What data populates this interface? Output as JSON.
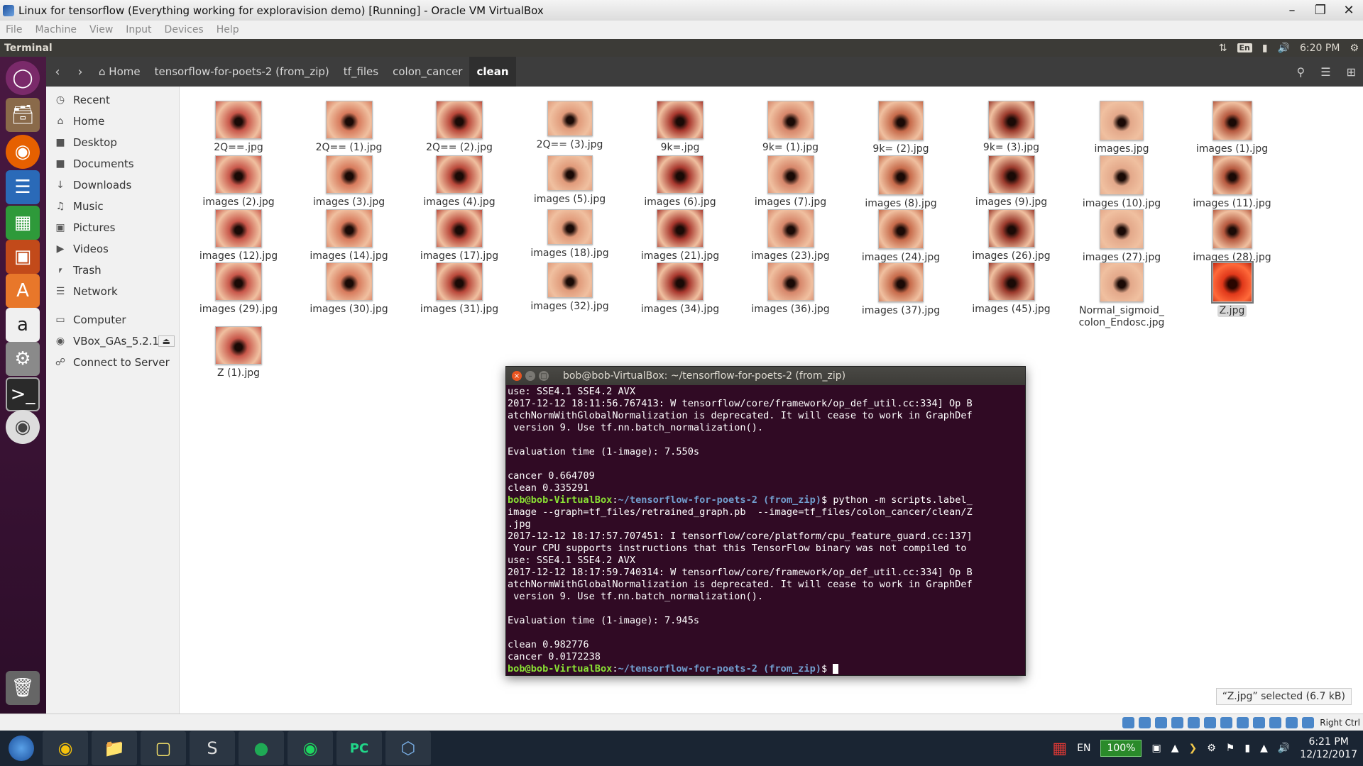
{
  "vbox": {
    "title": "Linux for tensorflow (Everything working for exploravision demo) [Running] - Oracle VM VirtualBox",
    "menu": [
      "File",
      "Machine",
      "View",
      "Input",
      "Devices",
      "Help"
    ],
    "status_right": "Right Ctrl"
  },
  "panel": {
    "app_name": "Terminal",
    "keyboard": "En",
    "time": "6:20 PM"
  },
  "nautilus": {
    "breadcrumbs": [
      "Home",
      "tensorflow-for-poets-2 (from_zip)",
      "tf_files",
      "colon_cancer",
      "clean"
    ],
    "sidebar": [
      {
        "label": "Recent",
        "icon": "clock-icon"
      },
      {
        "label": "Home",
        "icon": "home-icon"
      },
      {
        "label": "Desktop",
        "icon": "folder-icon"
      },
      {
        "label": "Documents",
        "icon": "folder-icon"
      },
      {
        "label": "Downloads",
        "icon": "download-icon"
      },
      {
        "label": "Music",
        "icon": "music-icon"
      },
      {
        "label": "Pictures",
        "icon": "camera-icon"
      },
      {
        "label": "Videos",
        "icon": "video-icon"
      },
      {
        "label": "Trash",
        "icon": "trash-icon"
      },
      {
        "label": "Network",
        "icon": "network-icon"
      },
      {
        "label": "Computer",
        "icon": "computer-icon"
      },
      {
        "label": "VBox_GAs_5.2.1",
        "icon": "disc-icon"
      },
      {
        "label": "Connect to Server",
        "icon": "server-icon"
      }
    ],
    "files": [
      "2Q==.jpg",
      "2Q== (1).jpg",
      "2Q== (2).jpg",
      "2Q== (3).jpg",
      "9k=.jpg",
      "9k= (1).jpg",
      "9k= (2).jpg",
      "9k= (3).jpg",
      "images.jpg",
      "images (1).jpg",
      "images (2).jpg",
      "images (3).jpg",
      "images (4).jpg",
      "images (5).jpg",
      "images (6).jpg",
      "images (7).jpg",
      "images (8).jpg",
      "images (9).jpg",
      "images (10).jpg",
      "images (11).jpg",
      "images (12).jpg",
      "images (14).jpg",
      "images (17).jpg",
      "images (18).jpg",
      "images (21).jpg",
      "images (23).jpg",
      "images (24).jpg",
      "images (26).jpg",
      "images (27).jpg",
      "images (28).jpg",
      "images (29).jpg",
      "images (30).jpg",
      "images (31).jpg",
      "images (32).jpg",
      "images (34).jpg",
      "images (36).jpg",
      "images (37).jpg",
      "images (45).jpg",
      "Normal_sigmoid_\ncolon_Endosc.jpg",
      "Z.jpg",
      "Z (1).jpg"
    ],
    "selected_file": "Z.jpg",
    "status": "“Z.jpg” selected (6.7 kB)"
  },
  "terminal": {
    "title": "bob@bob-VirtualBox: ~/tensorflow-for-poets-2 (from_zip)",
    "prompt_user": "bob@bob-VirtualBox",
    "prompt_path": "~/tensorflow-for-poets-2 (from_zip)",
    "lines_before": "use: SSE4.1 SSE4.2 AVX\n2017-12-12 18:11:56.767413: W tensorflow/core/framework/op_def_util.cc:334] Op B\natchNormWithGlobalNormalization is deprecated. It will cease to work in GraphDef\n version 9. Use tf.nn.batch_normalization().\n\nEvaluation time (1-image): 7.550s\n\ncancer 0.664709\nclean 0.335291",
    "command": "python -m scripts.label_\nimage --graph=tf_files/retrained_graph.pb  --image=tf_files/colon_cancer/clean/Z\n.jpg",
    "lines_after": "2017-12-12 18:17:57.707451: I tensorflow/core/platform/cpu_feature_guard.cc:137]\n Your CPU supports instructions that this TensorFlow binary was not compiled to\nuse: SSE4.1 SSE4.2 AVX\n2017-12-12 18:17:59.740314: W tensorflow/core/framework/op_def_util.cc:334] Op B\natchNormWithGlobalNormalization is deprecated. It will cease to work in GraphDef\n version 9. Use tf.nn.batch_normalization().\n\nEvaluation time (1-image): 7.945s\n\nclean 0.982776\ncancer 0.0172238"
  },
  "windows": {
    "language": "EN",
    "battery": "100%",
    "time": "6:21 PM",
    "date": "12/12/2017"
  }
}
